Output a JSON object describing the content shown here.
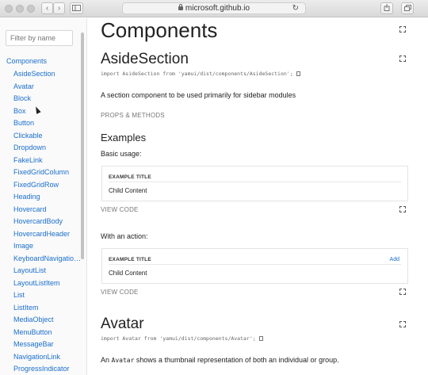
{
  "browser": {
    "url": "microsoft.github.io",
    "back": "‹",
    "forward": "›",
    "reload": "↻"
  },
  "sidebar": {
    "filter_placeholder": "Filter by name",
    "root_label": "Components",
    "items": [
      "AsideSection",
      "Avatar",
      "Block",
      "Box",
      "Button",
      "Clickable",
      "Dropdown",
      "FakeLink",
      "FixedGridColumn",
      "FixedGridRow",
      "Heading",
      "Hovercard",
      "HovercardBody",
      "HovercardHeader",
      "Image",
      "KeyboardNavigation...",
      "LayoutList",
      "LayoutListItem",
      "List",
      "ListItem",
      "MediaObject",
      "MenuButton",
      "MessageBar",
      "NavigationLink",
      "ProgressIndicator"
    ]
  },
  "main": {
    "page_title": "Components",
    "aside": {
      "title": "AsideSection",
      "import": "import AsideSection from 'yamui/dist/components/AsideSection';",
      "description": "A section component to be used primarily for sidebar modules",
      "props_label": "PROPS & METHODS",
      "examples_heading": "Examples",
      "basic_label": "Basic usage:",
      "example1": {
        "title": "EXAMPLE TITLE",
        "content": "Child Content"
      },
      "view_code_1": "VIEW CODE",
      "action_label": "With an action:",
      "example2": {
        "title": "EXAMPLE TITLE",
        "content": "Child Content",
        "action": "Add"
      },
      "view_code_2": "VIEW CODE"
    },
    "avatar": {
      "title": "Avatar",
      "import": "import Avatar from 'yamui/dist/components/Avatar';",
      "desc_prefix": "An ",
      "desc_code": "Avatar",
      "desc_suffix": " shows a thumbnail representation of both an individual or group."
    }
  }
}
